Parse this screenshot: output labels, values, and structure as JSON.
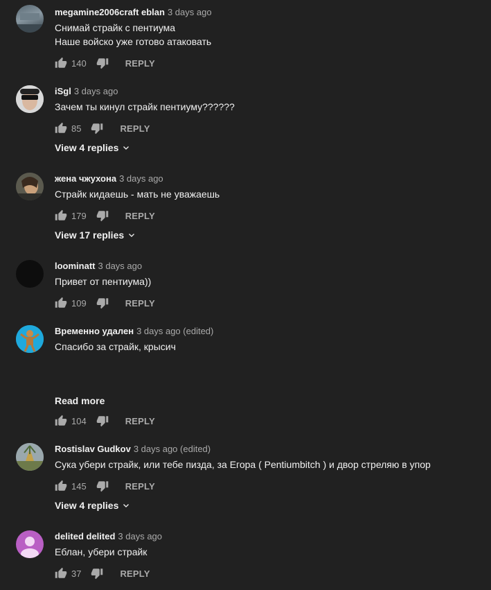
{
  "comments": [
    {
      "author": "megamine2006craft eblan",
      "time": "3 days ago",
      "lines": [
        "Снимай страйк с пентиума",
        "Наше войско уже готово атаковать"
      ],
      "likes": "140",
      "reply_label": "REPLY"
    },
    {
      "author": "iSgl",
      "time": "3 days ago",
      "lines": [
        "Зачем ты кинул страйк пентиуму??????"
      ],
      "likes": "85",
      "reply_label": "REPLY",
      "view_replies": "View 4 replies"
    },
    {
      "author": "жена чжухона",
      "time": "3 days ago",
      "lines": [
        "Страйк кидаешь - мать не уважаешь"
      ],
      "likes": "179",
      "reply_label": "REPLY",
      "view_replies": "View 17 replies"
    },
    {
      "author": "loominatt",
      "time": "3 days ago",
      "lines": [
        "Привет от пентиума))"
      ],
      "likes": "109",
      "reply_label": "REPLY"
    },
    {
      "author": "Временно удален",
      "time": "3 days ago (edited)",
      "lines": [
        "Спасибо за страйк, крысич"
      ],
      "read_more": "Read more",
      "likes": "104",
      "reply_label": "REPLY"
    },
    {
      "author": "Rostislav Gudkov",
      "time": "3 days ago (edited)",
      "lines": [
        "Сука убери страйк, или тебе пизда, за Егора ( Pentiumbitch ) и двор стреляю в упор"
      ],
      "likes": "145",
      "reply_label": "REPLY",
      "view_replies": "View 4 replies"
    },
    {
      "author": "delited delited",
      "time": "3 days ago",
      "lines": [
        "Еблан, убери страйк"
      ],
      "likes": "37",
      "reply_label": "REPLY"
    }
  ],
  "colors": {
    "background": "#212121",
    "text_primary": "#f1f1f1",
    "text_secondary": "#aaaaaa",
    "default_avatar": "#b95fc4"
  }
}
